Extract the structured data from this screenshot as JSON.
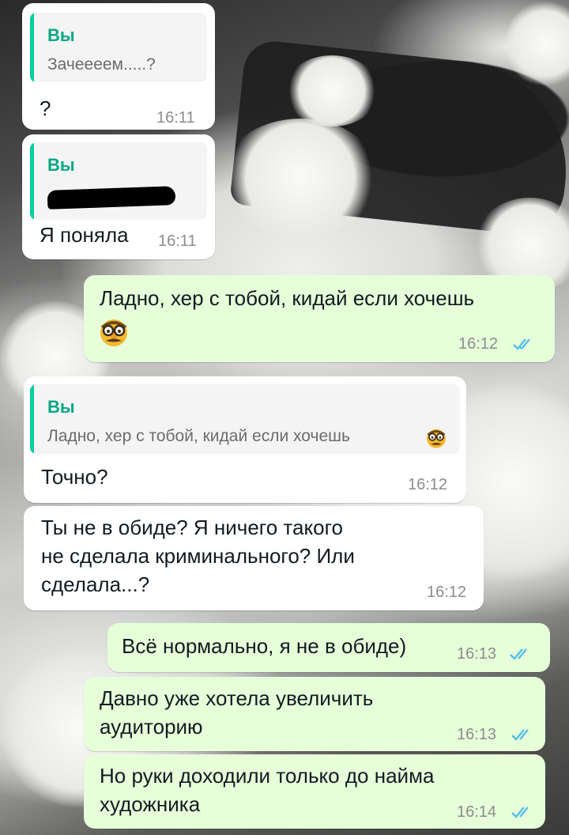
{
  "chat": {
    "messages": [
      {
        "direction": "incoming",
        "reply_to": {
          "author": "Вы",
          "text": "Зачеееем.....?"
        },
        "text": "?",
        "time": "16:11"
      },
      {
        "direction": "incoming",
        "reply_to": {
          "author": "Вы",
          "text": "",
          "redacted": true
        },
        "text": "Я поняла",
        "time": "16:11"
      },
      {
        "direction": "outgoing",
        "text": "Ладно, хер с тобой, кидай если хочешь",
        "emoji": "nerd-disguise-face",
        "time": "16:12",
        "status": "read"
      },
      {
        "direction": "incoming",
        "reply_to": {
          "author": "Вы",
          "text": "Ладно, хер с тобой, кидай если хочешь"
        },
        "text": "Точно?",
        "time": "16:12"
      },
      {
        "direction": "incoming",
        "lines": [
          "Ты не в обиде? Я ничего такого",
          "не сделала криминального? Или",
          "сделала...?"
        ],
        "time": "16:12"
      },
      {
        "direction": "outgoing",
        "text": "Всё нормально, я не в обиде)",
        "time": "16:13",
        "status": "read"
      },
      {
        "direction": "outgoing",
        "lines": [
          "Давно уже хотела увеличить",
          "аудиторию"
        ],
        "time": "16:13",
        "status": "read"
      },
      {
        "direction": "outgoing",
        "lines": [
          "Но руки доходили только до найма",
          "художника"
        ],
        "time": "16:14",
        "status": "read"
      }
    ]
  },
  "colors": {
    "incoming_bubble": "#ffffff",
    "outgoing_bubble": "#e6ffd9",
    "quote_bar": "#06cf9c",
    "quote_author": "#06a884",
    "read_ticks": "#53bdeb"
  }
}
